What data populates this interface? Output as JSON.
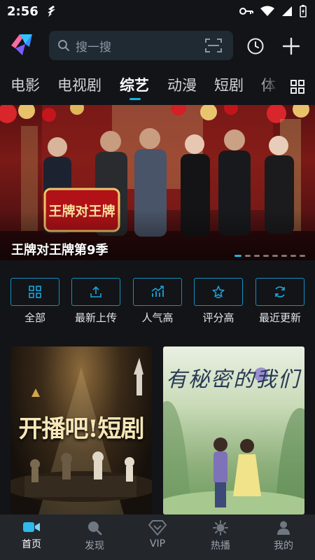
{
  "status_bar": {
    "time": "2:56"
  },
  "search": {
    "placeholder": "搜一搜"
  },
  "tabs": [
    {
      "label": "电影"
    },
    {
      "label": "电视剧"
    },
    {
      "label": "综艺",
      "active": true
    },
    {
      "label": "动漫"
    },
    {
      "label": "短剧"
    },
    {
      "label": "体"
    }
  ],
  "banner": {
    "title": "王牌对王牌第9季",
    "logo_text": "王牌对王牌",
    "dot_count": 8,
    "active_dot": 0
  },
  "filters": [
    {
      "label": "全部",
      "icon": "grid-icon"
    },
    {
      "label": "最新上传",
      "icon": "upload-icon"
    },
    {
      "label": "人气高",
      "icon": "trend-chart-icon"
    },
    {
      "label": "评分高",
      "icon": "star-icon"
    },
    {
      "label": "最近更新",
      "icon": "refresh-icon"
    }
  ],
  "posters": [
    {
      "text": "开播吧!短剧"
    },
    {
      "text": "有秘密的我们"
    }
  ],
  "bottom_nav": [
    {
      "label": "首页",
      "icon": "video-camera-icon",
      "active": true
    },
    {
      "label": "发现",
      "icon": "search-icon"
    },
    {
      "label": "VIP",
      "icon": "diamond-icon"
    },
    {
      "label": "热播",
      "icon": "sun-icon"
    },
    {
      "label": "我的",
      "icon": "person-icon"
    }
  ],
  "colors": {
    "accent": "#17b3e6",
    "background": "#121418",
    "nav_background": "#23262b",
    "search_background": "#1f2a33"
  }
}
